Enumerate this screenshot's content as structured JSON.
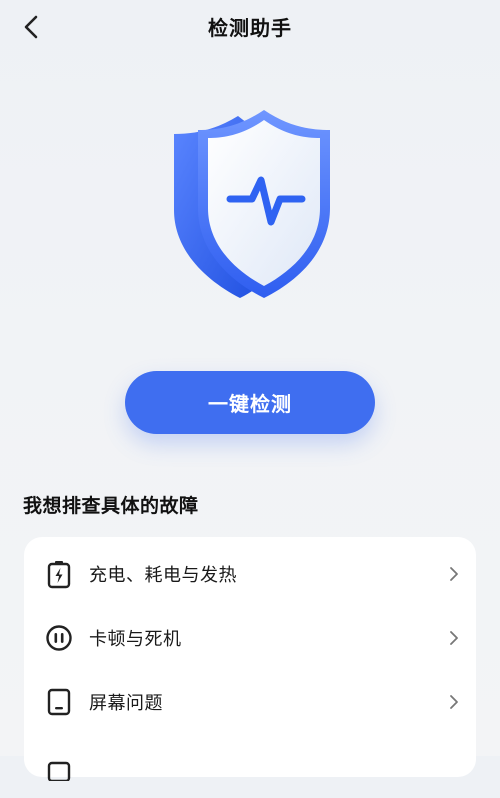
{
  "header": {
    "back_icon": "chevron-left-icon",
    "title": "检测助手"
  },
  "hero": {
    "icon": "shield-pulse-icon",
    "accent": "#3f6ef0"
  },
  "primary_action": {
    "label": "一键检测",
    "color": "#3f6ef0"
  },
  "troubleshoot": {
    "title": "我想排查具体的故障",
    "items": [
      {
        "label": "充电、耗电与发热",
        "icon": "battery-charging-icon"
      },
      {
        "label": "卡顿与死机",
        "icon": "pause-circle-icon"
      },
      {
        "label": "屏幕问题",
        "icon": "tablet-icon"
      },
      {
        "label": "",
        "icon": "generic-icon"
      }
    ]
  }
}
